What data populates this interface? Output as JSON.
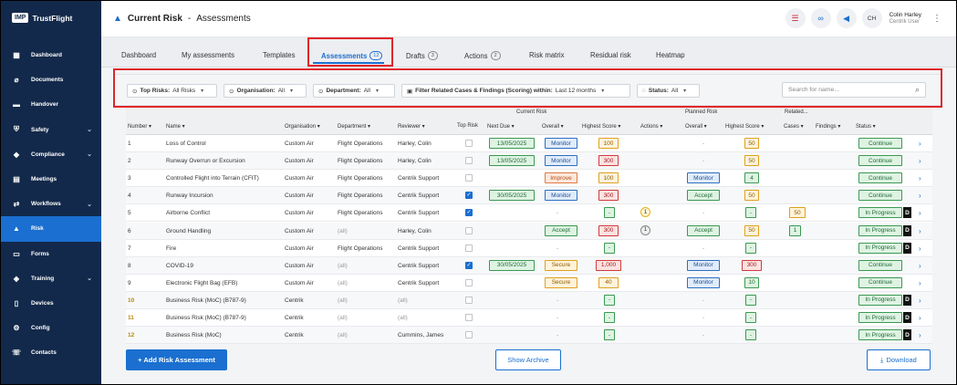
{
  "app": {
    "logo_box": "IMP",
    "logo_text": "TrustFlight"
  },
  "sidebar": {
    "items": [
      {
        "label": "Dashboard",
        "icon": "dashboard-icon",
        "glyph": "▦",
        "chevron": false
      },
      {
        "label": "Documents",
        "icon": "paperclip-icon",
        "glyph": "⌀",
        "chevron": false
      },
      {
        "label": "Handover",
        "icon": "handover-icon",
        "glyph": "▬",
        "chevron": false
      },
      {
        "label": "Safety",
        "icon": "shield-icon",
        "glyph": "⛨",
        "chevron": true
      },
      {
        "label": "Compliance",
        "icon": "compliance-icon",
        "glyph": "◆",
        "chevron": true
      },
      {
        "label": "Meetings",
        "icon": "meetings-icon",
        "glyph": "▤",
        "chevron": false
      },
      {
        "label": "Workflows",
        "icon": "workflows-icon",
        "glyph": "⇄",
        "chevron": true
      },
      {
        "label": "Risk",
        "icon": "risk-icon",
        "glyph": "▲",
        "chevron": false,
        "active": true
      },
      {
        "label": "Forms",
        "icon": "forms-icon",
        "glyph": "▭",
        "chevron": false
      },
      {
        "label": "Training",
        "icon": "training-icon",
        "glyph": "◈",
        "chevron": true
      },
      {
        "label": "Devices",
        "icon": "devices-icon",
        "glyph": "▯",
        "chevron": false
      },
      {
        "label": "Config",
        "icon": "config-icon",
        "glyph": "⚙",
        "chevron": false
      },
      {
        "label": "Contacts",
        "icon": "contacts-icon",
        "glyph": "☏",
        "chevron": false
      }
    ]
  },
  "header": {
    "title": "Current Risk",
    "subtitle": "Assessments",
    "separator": "-",
    "user_initials": "CH",
    "user_name": "Colin Harley",
    "user_role": "Centrik User"
  },
  "tabs": [
    {
      "label": "Dashboard",
      "count": ""
    },
    {
      "label": "My assessments",
      "count": ""
    },
    {
      "label": "Templates",
      "count": ""
    },
    {
      "label": "Assessments",
      "count": "12",
      "active": true
    },
    {
      "label": "Drafts",
      "count": "3"
    },
    {
      "label": "Actions",
      "count": "2"
    },
    {
      "label": "Risk matrix",
      "count": ""
    },
    {
      "label": "Residual risk",
      "count": ""
    },
    {
      "label": "Heatmap",
      "count": ""
    }
  ],
  "filters": [
    {
      "label": "Top Risks:",
      "value": "All Risks"
    },
    {
      "label": "Organisation:",
      "value": "All"
    },
    {
      "label": "Department:",
      "value": "All"
    },
    {
      "label": "Filter Related Cases & Findings (Scoring) within:",
      "value": "Last 12 months"
    },
    {
      "label": "Status:",
      "value": "All"
    }
  ],
  "search": {
    "placeholder": "Search for name..."
  },
  "table": {
    "group_headers": {
      "current": "Current Risk",
      "planned": "Planned Risk",
      "related": "Related..."
    },
    "columns": [
      "Number",
      "Name",
      "Organisation",
      "Department",
      "Reviewer",
      "Top Risk",
      "Next Due",
      "Overall",
      "Highest Score",
      "Actions",
      "Overall",
      "Highest Score",
      "Cases",
      "Findings",
      "Status"
    ],
    "rows": [
      {
        "num": "1",
        "name": "Loss of Control",
        "org": "Custom Air",
        "dept": "Flight Operations",
        "rev": "Harley, Colin",
        "top": false,
        "due": "13/05/2025",
        "cur": "Monitor",
        "curc": "blue",
        "score": "100",
        "scorec": "orange",
        "act": "",
        "plan": "-",
        "planc": "",
        "pscore": "50",
        "pscorec": "orange",
        "cases": "",
        "find": "",
        "status": "Continue",
        "statusc": "green",
        "d": false
      },
      {
        "num": "2",
        "name": "Runway Overrun or Excursion",
        "org": "Custom Air",
        "dept": "Flight Operations",
        "rev": "Harley, Colin",
        "top": false,
        "due": "13/05/2025",
        "cur": "Monitor",
        "curc": "blue",
        "score": "300",
        "scorec": "red",
        "act": "",
        "plan": "-",
        "planc": "",
        "pscore": "50",
        "pscorec": "orange",
        "cases": "",
        "find": "",
        "status": "Continue",
        "statusc": "green",
        "d": false
      },
      {
        "num": "3",
        "name": "Controlled Flight into Terrain (CFIT)",
        "org": "Custom Air",
        "dept": "Flight Operations",
        "rev": "Centrik Support",
        "top": false,
        "due": "",
        "cur": "Improve",
        "curc": "imp",
        "score": "100",
        "scorec": "orange",
        "act": "",
        "plan": "Monitor",
        "planc": "blue",
        "pscore": "4",
        "pscorec": "green",
        "cases": "",
        "find": "",
        "status": "Continue",
        "statusc": "green",
        "d": false
      },
      {
        "num": "4",
        "name": "Runway Incursion",
        "org": "Custom Air",
        "dept": "Flight Operations",
        "rev": "Centrik Support",
        "top": true,
        "due": "30/05/2025",
        "cur": "Monitor",
        "curc": "blue",
        "score": "300",
        "scorec": "red",
        "act": "",
        "plan": "Accept",
        "planc": "green",
        "pscore": "50",
        "pscorec": "orange",
        "cases": "",
        "find": "",
        "status": "Continue",
        "statusc": "green",
        "d": false
      },
      {
        "num": "5",
        "name": "Airborne Conflict",
        "org": "Custom Air",
        "dept": "Flight Operations",
        "rev": "Centrik Support",
        "top": true,
        "due": "",
        "cur": "-",
        "curc": "",
        "score": "-",
        "scorec": "green",
        "act": "1",
        "actc": "yel",
        "plan": "-",
        "planc": "",
        "pscore": "-",
        "pscorec": "green",
        "cases": "50",
        "casesc": "orange",
        "find": "",
        "status": "In Progress",
        "statusc": "green",
        "d": true
      },
      {
        "num": "6",
        "name": "Ground Handling",
        "org": "Custom Air",
        "dept": "(all)",
        "rev": "Harley, Colin",
        "top": false,
        "due": "",
        "cur": "Accept",
        "curc": "green",
        "score": "300",
        "scorec": "red",
        "act": "1",
        "actc": "gry",
        "plan": "Accept",
        "planc": "green",
        "pscore": "50",
        "pscorec": "orange",
        "cases": "1",
        "casesc": "green",
        "find": "",
        "status": "In Progress",
        "statusc": "green",
        "d": true
      },
      {
        "num": "7",
        "name": "Fire",
        "org": "Custom Air",
        "dept": "Flight Operations",
        "rev": "Centrik Support",
        "top": false,
        "due": "",
        "cur": "-",
        "curc": "",
        "score": "-",
        "scorec": "green",
        "act": "",
        "plan": "-",
        "planc": "",
        "pscore": "-",
        "pscorec": "green",
        "cases": "",
        "find": "",
        "status": "In Progress",
        "statusc": "green",
        "d": true
      },
      {
        "num": "8",
        "name": "COVID-19",
        "org": "Custom Air",
        "dept": "(all)",
        "rev": "Centrik Support",
        "top": true,
        "due": "30/05/2025",
        "cur": "Secure",
        "curc": "orange",
        "score": "1,000",
        "scorec": "red",
        "act": "",
        "plan": "Monitor",
        "planc": "blue",
        "pscore": "300",
        "pscorec": "red",
        "cases": "",
        "find": "",
        "status": "Continue",
        "statusc": "green",
        "d": false
      },
      {
        "num": "9",
        "name": "Electronic Flight Bag (EFB)",
        "org": "Custom Air",
        "dept": "(all)",
        "rev": "Centrik Support",
        "top": false,
        "due": "",
        "cur": "Secure",
        "curc": "orange",
        "score": "40",
        "scorec": "orange",
        "act": "",
        "plan": "Monitor",
        "planc": "blue",
        "pscore": "10",
        "pscorec": "green",
        "cases": "",
        "find": "",
        "status": "Continue",
        "statusc": "green",
        "d": false
      },
      {
        "num": "10",
        "name": "Business Risk (MoC) (B787-9)",
        "org": "Centrik",
        "dept": "(all)",
        "rev": "(all)",
        "top": false,
        "due": "",
        "cur": "-",
        "curc": "",
        "score": "-",
        "scorec": "green",
        "act": "",
        "plan": "-",
        "planc": "",
        "pscore": "-",
        "pscorec": "green",
        "cases": "",
        "find": "",
        "status": "In Progress",
        "statusc": "green",
        "d": true,
        "numc": "orange"
      },
      {
        "num": "11",
        "name": "Business Risk (MoC) (B787-9)",
        "org": "Centrik",
        "dept": "(all)",
        "rev": "(all)",
        "top": false,
        "due": "",
        "cur": "-",
        "curc": "",
        "score": "-",
        "scorec": "green",
        "act": "",
        "plan": "-",
        "planc": "",
        "pscore": "-",
        "pscorec": "green",
        "cases": "",
        "find": "",
        "status": "In Progress",
        "statusc": "green",
        "d": true,
        "numc": "orange"
      },
      {
        "num": "12",
        "name": "Business Risk (MoC)",
        "org": "Centrik",
        "dept": "(all)",
        "rev": "Cummins, James",
        "top": false,
        "due": "",
        "cur": "-",
        "curc": "",
        "score": "-",
        "scorec": "green",
        "act": "",
        "plan": "-",
        "planc": "",
        "pscore": "-",
        "pscorec": "green",
        "cases": "",
        "find": "",
        "status": "In Progress",
        "statusc": "green",
        "d": true,
        "numc": "orange"
      }
    ]
  },
  "buttons": {
    "add": "+ Add Risk Assessment",
    "archive": "Show Archive",
    "download": "Download"
  },
  "colors": {
    "accent": "#1a6fd0",
    "sidebar": "#13294b",
    "highlight": "#e0262b"
  }
}
